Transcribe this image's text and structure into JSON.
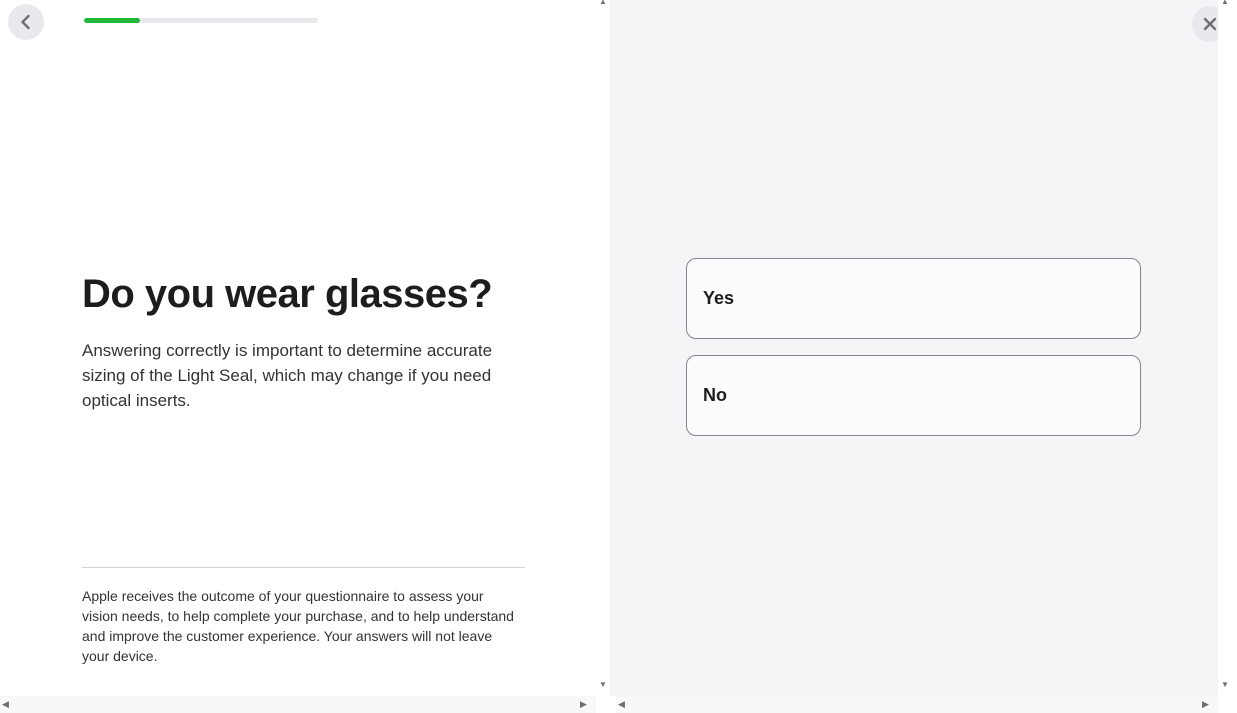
{
  "progress": {
    "value": 0.24,
    "fill_color": "#1fb839",
    "track_color": "#e8e8ed"
  },
  "header": {
    "back_icon": "chevron-left-icon",
    "close_icon": "close-icon"
  },
  "question": {
    "title": "Do you wear glasses?",
    "description": "Answering correctly is important to determine accurate sizing of the Light Seal, which may change if you need optical inserts."
  },
  "disclaimer": {
    "text": "Apple receives the outcome of your questionnaire to assess your vision needs, to help complete your purchase, and to help understand and improve the customer experience. Your answers will not leave your device."
  },
  "options": [
    {
      "label": "Yes"
    },
    {
      "label": "No"
    }
  ],
  "colors": {
    "right_pane_bg": "#f5f5f7",
    "option_border": "#86868b",
    "text_primary": "#1d1d1f"
  }
}
